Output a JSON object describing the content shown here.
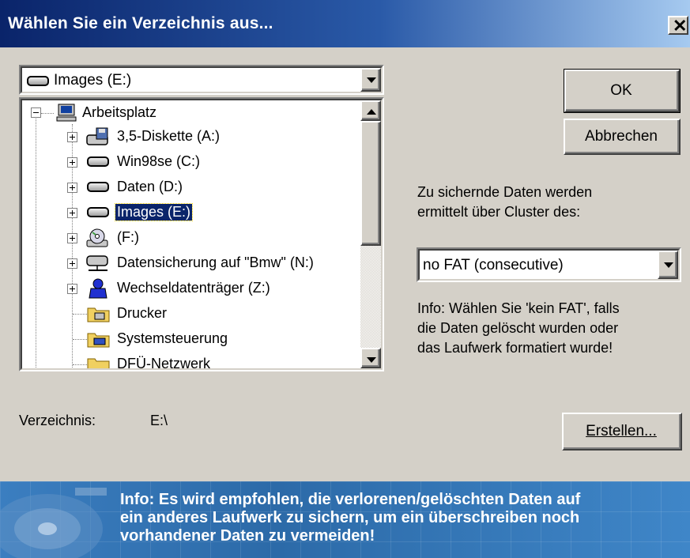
{
  "window": {
    "title": "Wählen Sie ein Verzeichnis aus..."
  },
  "drive_select": {
    "value": "Images (E:)"
  },
  "tree": {
    "items": [
      {
        "label": "Arbeitsplatz",
        "icon": "computer-icon",
        "expander": "minus"
      },
      {
        "label": "3,5-Diskette (A:)",
        "icon": "floppy-drive-icon",
        "expander": "plus"
      },
      {
        "label": "Win98se (C:)",
        "icon": "hard-drive-icon",
        "expander": "plus"
      },
      {
        "label": "Daten (D:)",
        "icon": "hard-drive-icon",
        "expander": "plus"
      },
      {
        "label": "Images (E:)",
        "icon": "hard-drive-icon",
        "expander": "plus",
        "selected": true
      },
      {
        "label": " (F:)",
        "icon": "cd-drive-icon",
        "expander": "plus"
      },
      {
        "label": "Datensicherung auf \"Bmw\" (N:)",
        "icon": "network-drive-icon",
        "expander": "plus"
      },
      {
        "label": "Wechseldatenträger (Z:)",
        "icon": "removable-drive-icon",
        "expander": "plus"
      },
      {
        "label": "Drucker",
        "icon": "printers-folder-icon",
        "expander": "none"
      },
      {
        "label": "Systemsteuerung",
        "icon": "control-panel-folder-icon",
        "expander": "none"
      },
      {
        "label": "DFÜ-Netzwerk",
        "icon": "dialup-folder-icon",
        "expander": "none"
      }
    ]
  },
  "buttons": {
    "ok": "OK",
    "cancel": "Abbrechen",
    "create": "Erstellen..."
  },
  "cluster_label": {
    "line1": "Zu sichernde Daten werden",
    "line2": "ermittelt über Cluster des:"
  },
  "fat_select": {
    "value": "no FAT (consecutive)"
  },
  "info_text": {
    "line1": "Info: Wählen Sie 'kein FAT', falls",
    "line2": "die Daten gelöscht wurden oder",
    "line3": "das Laufwerk formatiert wurde!"
  },
  "directory": {
    "label": "Verzeichnis:",
    "value": "E:\\"
  },
  "banner": {
    "line1": "Info: Es wird empfohlen, die verlorenen/gelöschten Daten auf",
    "line2": "ein anderes Laufwerk zu sichern, um ein überschreiben noch",
    "line3": "vorhandener Daten zu vermeiden!"
  },
  "colors": {
    "title_bar": "#0a246a",
    "selection": "#0a246a",
    "face": "#d4d0c8",
    "banner": "#2e6fb0"
  }
}
